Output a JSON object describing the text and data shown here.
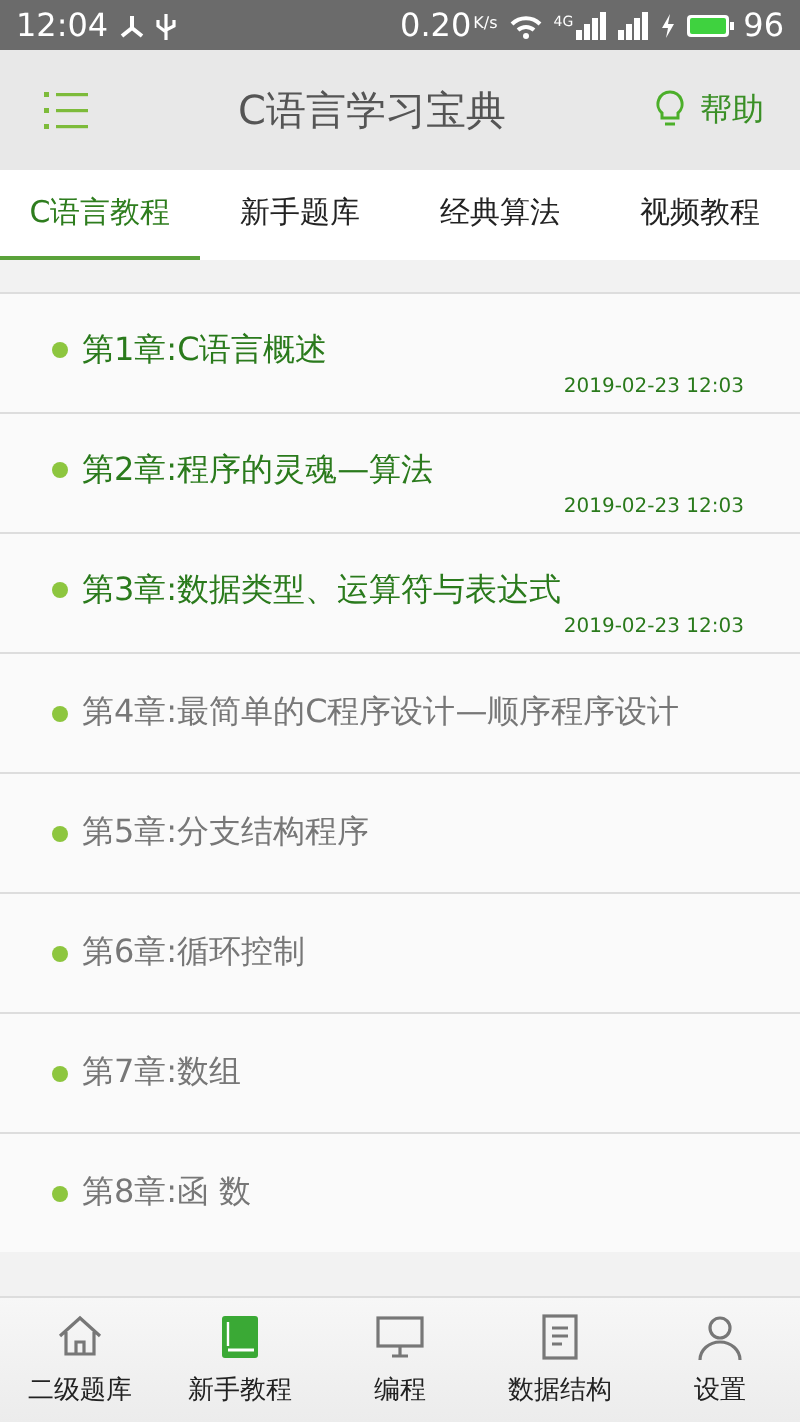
{
  "status_bar": {
    "time": "12:04",
    "speed": "0.20",
    "speed_unit": "K/s",
    "network": "4G",
    "battery": "96"
  },
  "header": {
    "title": "C语言学习宝典",
    "help": "帮助"
  },
  "tabs": [
    {
      "label": "C语言教程",
      "selected": true
    },
    {
      "label": "新手题库",
      "selected": false
    },
    {
      "label": "经典算法",
      "selected": false
    },
    {
      "label": "视频教程",
      "selected": false
    }
  ],
  "chapters": [
    {
      "title": "第1章:C语言概述",
      "visited": true,
      "time": "2019-02-23 12:03"
    },
    {
      "title": "第2章:程序的灵魂—算法",
      "visited": true,
      "time": "2019-02-23 12:03"
    },
    {
      "title": "第3章:数据类型、运算符与表达式",
      "visited": true,
      "time": "2019-02-23 12:03"
    },
    {
      "title": "第4章:最简单的C程序设计—顺序程序设计",
      "visited": false
    },
    {
      "title": "第5章:分支结构程序",
      "visited": false
    },
    {
      "title": "第6章:循环控制",
      "visited": false
    },
    {
      "title": "第7章:数组",
      "visited": false
    },
    {
      "title": "第8章:函 数",
      "visited": false
    }
  ],
  "bottom_nav": [
    {
      "label": "二级题库",
      "kind": "house",
      "selected": false
    },
    {
      "label": "新手教程",
      "kind": "book",
      "selected": true
    },
    {
      "label": "编程",
      "kind": "monitor",
      "selected": false
    },
    {
      "label": "数据结构",
      "kind": "document",
      "selected": false
    },
    {
      "label": "设置",
      "kind": "person",
      "selected": false
    }
  ]
}
